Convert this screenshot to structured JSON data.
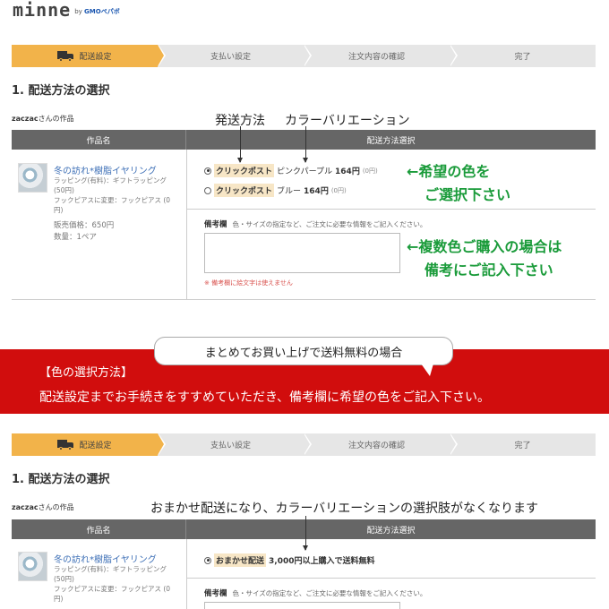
{
  "header": {
    "logo": "minne",
    "logo_by": "by",
    "logo_company": "GMOペパボ"
  },
  "steps": [
    "配送設定",
    "支払い設定",
    "注文内容の確認",
    "完了"
  ],
  "section_title": "1. 配送方法の選択",
  "shop": {
    "name": "zaczac",
    "suffix": "さんの作品"
  },
  "table": {
    "col_item": "作品名",
    "col_shipping": "配送方法選択"
  },
  "product": {
    "name": "冬の訪れ*樹脂イヤリング",
    "wrapping": "ラッピング(有料)：ギフトラッピング",
    "wrapping_price": "(50円)",
    "change": "フックピアスに変更：フックピアス (0",
    "change2": "円)",
    "price": "販売価格：650円",
    "qty": "数量：1ペア"
  },
  "options_top": [
    {
      "method": "クリックポスト",
      "color": "ピンクパープル",
      "price": "164円",
      "extra": "(0円)",
      "selected": true
    },
    {
      "method": "クリックポスト",
      "color": "ブルー",
      "price": "164円",
      "extra": "(0円)",
      "selected": false
    }
  ],
  "note": {
    "label": "備考欄",
    "hint": "色・サイズの指定など、ご注文に必要な情報をご記入ください。",
    "warning": "※ 備考欄に絵文字は使えません"
  },
  "annotations": {
    "method": "発送方法",
    "variation": "カラーバリエーション",
    "green1a": "←希望の色を",
    "green1b": "ご選択下さい",
    "green2a": "←複数色ご購入の場合は",
    "green2b": "備考にご記入下さい",
    "bottom_note": "おまかせ配送になり、カラーバリエーションの選択肢がなくなります"
  },
  "banner": {
    "bubble": "まとめてお買い上げで送料無料の場合",
    "title": "【色の選択方法】",
    "text": "配送設定までお手続きをすすめていただき、備考欄に希望の色をご記入下さい。"
  },
  "option_bottom": {
    "method": "おまかせ配送",
    "desc": "3,000円以上購入で送料無料",
    "selected": true
  },
  "colors": {
    "accent": "#f2b34a",
    "banner": "#d10d0d",
    "green": "#1a9b3a",
    "link": "#3d6fb6"
  }
}
